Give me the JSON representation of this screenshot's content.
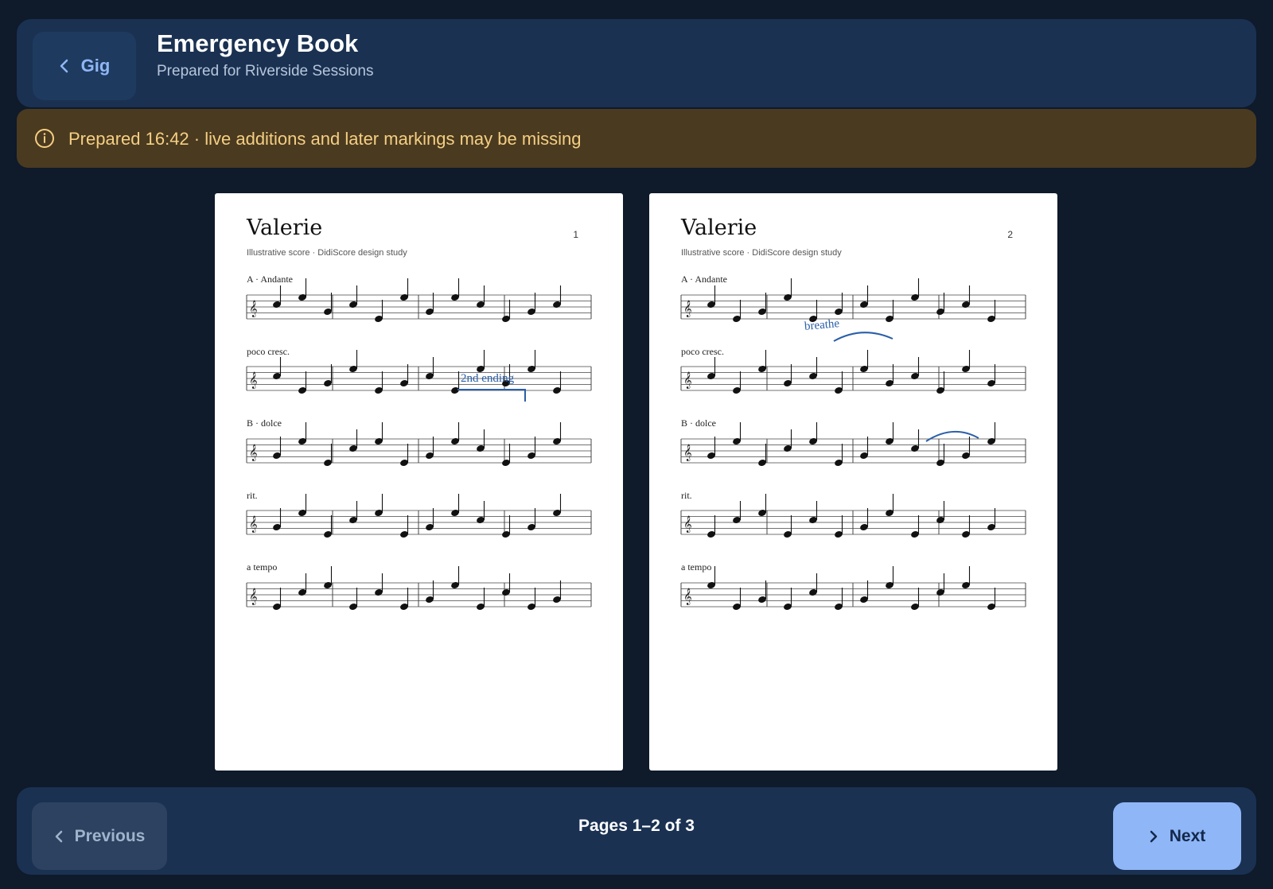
{
  "header": {
    "back_label": "Gig",
    "title": "Emergency Book",
    "subtitle": "Prepared for Riverside Sessions"
  },
  "warning": {
    "icon": "info-icon",
    "text": "Prepared 16:42 · live additions and later markings may be missing"
  },
  "pages": [
    {
      "title": "Valerie",
      "number": "1",
      "subtitle": "Illustrative score · DidiScore design study",
      "staff_labels": [
        "A · Andante",
        "poco cresc.",
        "B · dolce",
        "rit.",
        "a tempo"
      ],
      "annotation": "2nd ending"
    },
    {
      "title": "Valerie",
      "number": "2",
      "subtitle": "Illustrative score · DidiScore design study",
      "staff_labels": [
        "A · Andante",
        "poco cresc.",
        "B · dolce",
        "rit.",
        "a tempo"
      ],
      "annotation": "breathe"
    }
  ],
  "footer": {
    "previous_label": "Previous",
    "next_label": "Next",
    "pages_indicator": "Pages 1–2 of 3"
  },
  "colors": {
    "background": "#0f1a2a",
    "panel": "#1a3152",
    "warning_bg": "#4a3a20",
    "warning_text": "#f5cf82",
    "accent": "#8fb6f7",
    "annotation_ink": "#2a5fa8"
  }
}
